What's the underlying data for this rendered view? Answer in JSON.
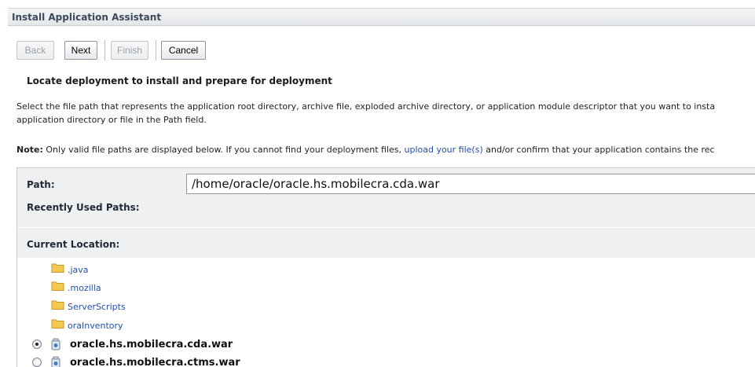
{
  "window": {
    "title": "Install Application Assistant"
  },
  "toolbar": {
    "back_label": "Back",
    "next_label": "Next",
    "finish_label": "Finish",
    "cancel_label": "Cancel"
  },
  "main": {
    "heading": "Locate deployment to install and prepare for deployment",
    "description_line1": "Select the file path that represents the application root directory, archive file, exploded archive directory, or application module descriptor that you want to insta",
    "description_line2": "application directory or file in the Path field.",
    "note_label": "Note:",
    "note_text_before": " Only valid file paths are displayed below. If you cannot find your deployment files, ",
    "note_link": "upload your file(s)",
    "note_text_after": " and/or confirm that your application contains the rec"
  },
  "path_form": {
    "path_label": "Path:",
    "path_value": "/home/oracle/oracle.hs.mobilecra.cda.war",
    "recent_label": "Recently Used Paths:",
    "current_label": "Current Location:"
  },
  "folders": [
    {
      "name": ".java"
    },
    {
      "name": ".mozilla"
    },
    {
      "name": "ServerScripts"
    },
    {
      "name": "oraInventory"
    }
  ],
  "files": [
    {
      "name": "oracle.hs.mobilecra.cda.war",
      "selected": true
    },
    {
      "name": "oracle.hs.mobilecra.ctms.war",
      "selected": false
    }
  ],
  "colors": {
    "link": "#2050a8",
    "folder": "#f0c040",
    "title_text": "#3b4a5a"
  }
}
